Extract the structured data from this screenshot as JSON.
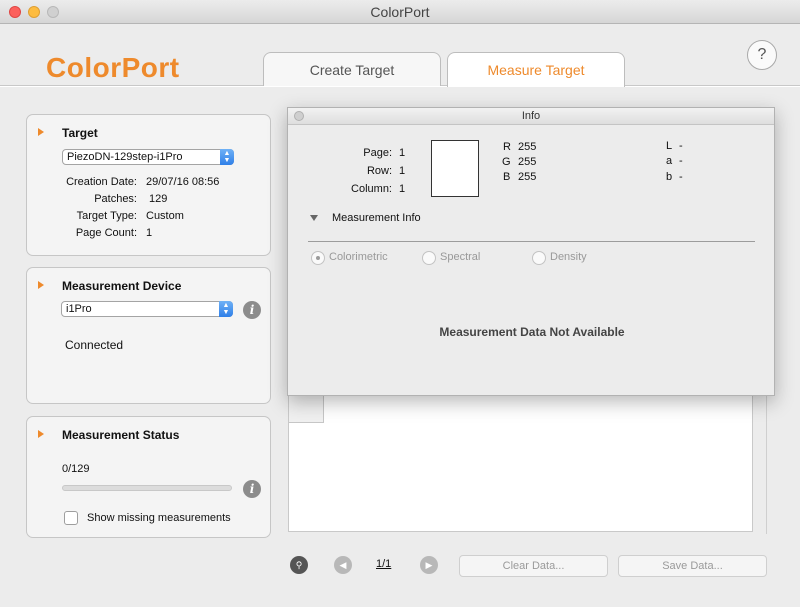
{
  "window": {
    "title": "ColorPort"
  },
  "app": {
    "logo": "ColorPort",
    "help": "?"
  },
  "tabs": [
    {
      "label": "Create Target",
      "active": false
    },
    {
      "label": "Measure Target",
      "active": true
    }
  ],
  "target": {
    "title": "Target",
    "selected": "PiezoDN-129step-i1Pro",
    "fields": [
      {
        "label": "Creation Date:",
        "value": "29/07/16 08:56"
      },
      {
        "label": "Patches:",
        "value": "129"
      },
      {
        "label": "Target Type:",
        "value": "Custom"
      },
      {
        "label": "Page Count:",
        "value": "1"
      }
    ]
  },
  "device": {
    "title": "Measurement Device",
    "selected": "i1Pro",
    "status": "Connected"
  },
  "status": {
    "title": "Measurement Status",
    "count": "0/129",
    "progress": 0,
    "show_missing_label": "Show missing measurements",
    "show_missing_checked": false
  },
  "bottom": {
    "page": "1/1",
    "clear_label": "Clear Data...",
    "save_label": "Save Data..."
  },
  "info": {
    "title": "Info",
    "page_label": "Page:",
    "page_value": "1",
    "row_label": "Row:",
    "row_value": "1",
    "column_label": "Column:",
    "column_value": "1",
    "r_label": "R",
    "r_value": "255",
    "g_label": "G",
    "g_value": "255",
    "b_label": "B",
    "b_value": "255",
    "l_label": "L",
    "l_value": "-",
    "a_label": "a",
    "a_value": "-",
    "lab_b_label": "b",
    "lab_b_value": "-",
    "measurement_info_label": "Measurement Info",
    "modes": [
      {
        "label": "Colorimetric",
        "selected": true
      },
      {
        "label": "Spectral",
        "selected": false
      },
      {
        "label": "Density",
        "selected": false
      }
    ],
    "message": "Measurement Data Not Available"
  },
  "colors": {
    "accent": "#ee8a2c",
    "select_blue": "#2f7fe8"
  }
}
